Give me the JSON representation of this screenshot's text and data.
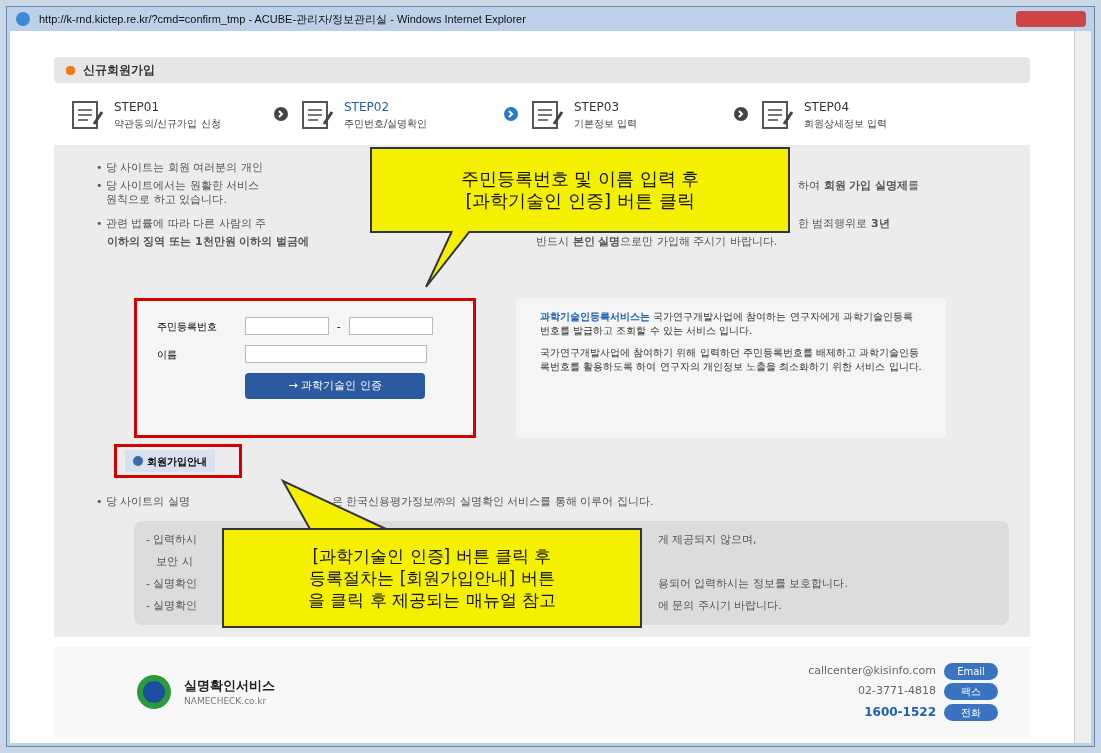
{
  "window": {
    "title": "http://k-rnd.kictep.re.kr/?cmd=confirm_tmp - ACUBE-관리자/정보관리실 - Windows Internet Explorer"
  },
  "page_title": "신규회원가입",
  "steps": [
    {
      "label": "STEP01",
      "caption": "약관동의/신규가입 신청",
      "selected": false
    },
    {
      "label": "STEP02",
      "caption": "주민번호/실명확인",
      "selected": true
    },
    {
      "label": "STEP03",
      "caption": "기본정보 입력",
      "selected": false
    },
    {
      "label": "STEP04",
      "caption": "회원상세정보 입력",
      "selected": false
    }
  ],
  "notices": [
    {
      "left": "• 당 사이트는 회원 여러분의 개인"
    },
    {
      "left": "• 당 사이트에서는 원활한 서비스",
      "right": "하여 **회원 가입 실명제**를"
    },
    {
      "left": "   원칙으로 하고 있습니다."
    },
    {
      "left": "• 관련 법률에 따라 다른 사람의 주",
      "right": "한 범죄행위로 **3년**"
    },
    {
      "left": "   **이하의 징역 또는 1천만원 이하의 벌금에**",
      "right": "반드시 **본인 실명**으로만 가입해 주시기 바랍니다."
    }
  ],
  "form": {
    "ssn_label": "주민등록번호",
    "ssn_separator": "-",
    "name_label": "이름",
    "submit": "→ 과학기술인 인증"
  },
  "info": {
    "lead": "과학기술인등록서비스는",
    "p1": "국가연구개발사업에 참여하는 연구자에게 과학기술인등록번호를 발급하고 조회할 수 있는 서비스 입니다.",
    "p2": "국가연구개발사업에 참여하기 위해 입력하던 주민등록번호를 배제하고 과학기술인등록번호를 활용하도록 하여 연구자의 개인정보 노출을 최소화하기 위한 서비스 입니다."
  },
  "guide_button": "회원가입안내",
  "realname_notice": {
    "left": "• 당 사이트의 실명",
    "right": "은 한국신용평가정보㈜의 실명확인 서비스를 통해 이루어 집니다."
  },
  "realname_box": [
    {
      "left": "- 입력하시",
      "right": "게 제공되지 않으며,"
    },
    {
      "left": "   보안 시"
    },
    {
      "left": "- 실명확인",
      "right": "용되어 입력하시는 정보를 보호합니다."
    },
    {
      "left": "- 실명확인",
      "right": "에 문의 주시기 바랍니다."
    }
  ],
  "callouts": [
    "주민등록번호 및 이름 입력 후\n[과학기술인 인증] 버튼 클릭",
    "[과학기술인 인증] 버튼 클릭 후\n등록절차는 [회원가입안내] 버튼\n을 클릭 후 제공되는 매뉴얼 참고"
  ],
  "footer": {
    "brand": "실명확인서비스",
    "brand_sub": "NAMECHECK.co.kr",
    "contacts": [
      {
        "text": "callcenter@kisinfo.com",
        "badge": "Email",
        "strong": false
      },
      {
        "text": "02-3771-4818",
        "badge": "팩스",
        "strong": false
      },
      {
        "text": "1600-1522",
        "badge": "전화",
        "strong": true
      }
    ]
  }
}
